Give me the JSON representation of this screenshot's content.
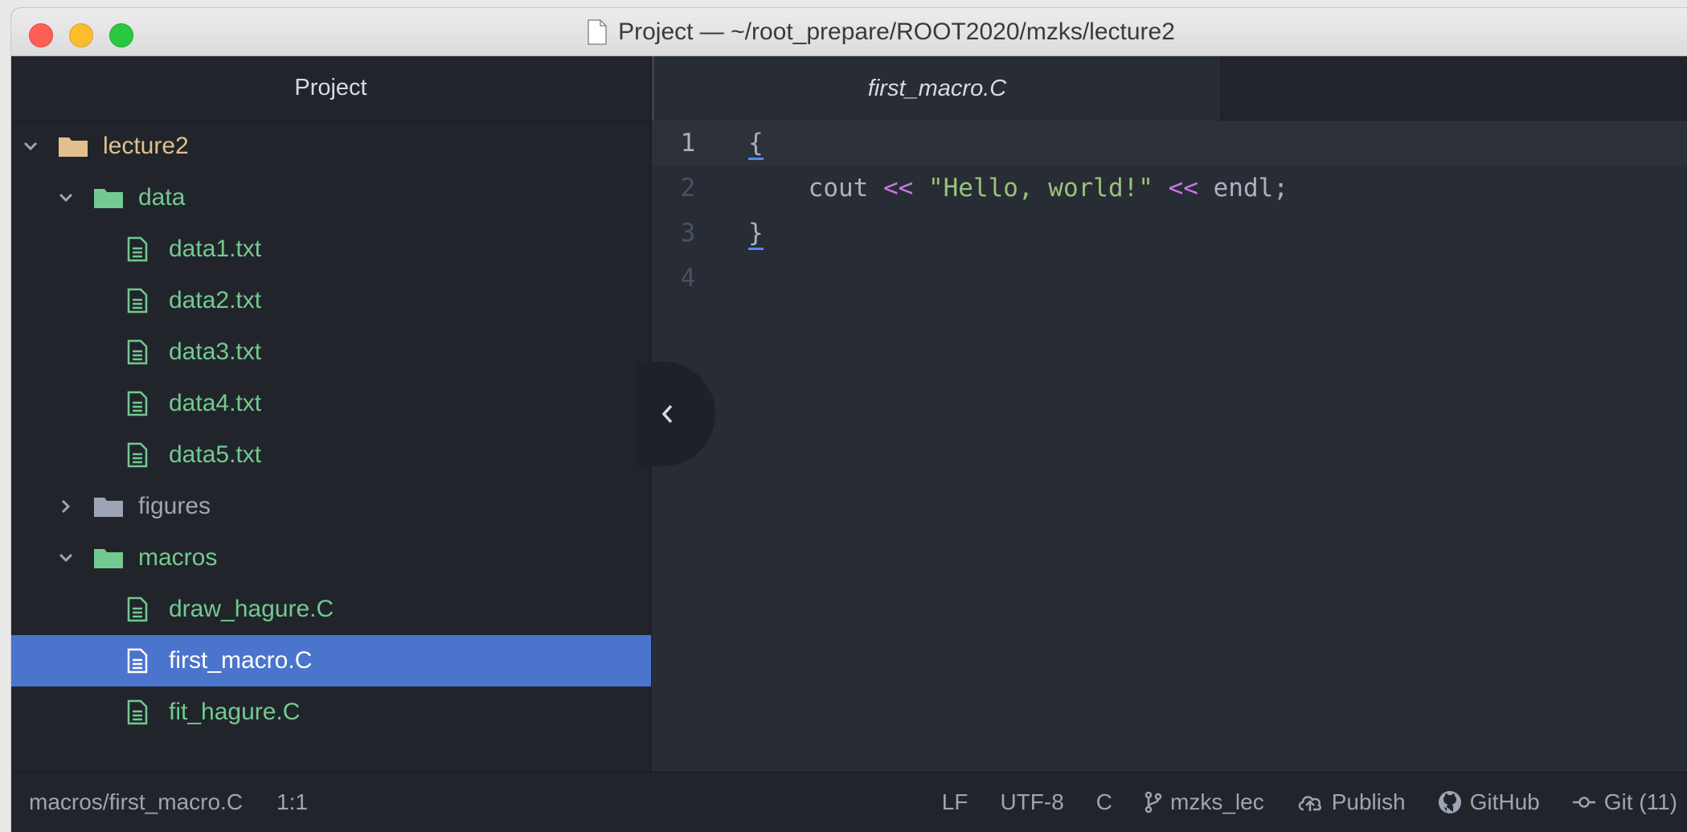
{
  "window": {
    "title": "Project — ~/root_prepare/ROOT2020/mzks/lecture2"
  },
  "sidebar": {
    "header": "Project",
    "tree": [
      {
        "label": "lecture2",
        "kind": "folder",
        "depth": 0,
        "expanded": true,
        "color": "tan"
      },
      {
        "label": "data",
        "kind": "folder",
        "depth": 1,
        "expanded": true,
        "color": "green"
      },
      {
        "label": "data1.txt",
        "kind": "file",
        "depth": 2,
        "color": "green"
      },
      {
        "label": "data2.txt",
        "kind": "file",
        "depth": 2,
        "color": "green"
      },
      {
        "label": "data3.txt",
        "kind": "file",
        "depth": 2,
        "color": "green"
      },
      {
        "label": "data4.txt",
        "kind": "file",
        "depth": 2,
        "color": "green"
      },
      {
        "label": "data5.txt",
        "kind": "file",
        "depth": 2,
        "color": "green"
      },
      {
        "label": "figures",
        "kind": "folder",
        "depth": 1,
        "expanded": false,
        "color": "grey"
      },
      {
        "label": "macros",
        "kind": "folder",
        "depth": 1,
        "expanded": true,
        "color": "green"
      },
      {
        "label": "draw_hagure.C",
        "kind": "file",
        "depth": 2,
        "color": "green"
      },
      {
        "label": "first_macro.C",
        "kind": "file",
        "depth": 2,
        "color": "white",
        "selected": true
      },
      {
        "label": "fit_hagure.C",
        "kind": "file",
        "depth": 2,
        "color": "green"
      }
    ]
  },
  "editor": {
    "tab_label": "first_macro.C",
    "line_numbers": [
      "1",
      "2",
      "3",
      "4"
    ],
    "lines": {
      "l1": "{",
      "l2_indent": "    cout ",
      "l2_op1": "<<",
      "l2_sp1": " ",
      "l2_str": "\"Hello, world!\"",
      "l2_sp2": " ",
      "l2_op2": "<<",
      "l2_tail": " endl;",
      "l3": "}",
      "l4": ""
    }
  },
  "statusbar": {
    "file_path": "macros/first_macro.C",
    "cursor": "1:1",
    "line_ending": "LF",
    "encoding": "UTF-8",
    "grammar": "C",
    "branch": "mzks_lec",
    "publish": "Publish",
    "github": "GitHub",
    "git": "Git (11)"
  },
  "colors": {
    "background": "#21252b",
    "editor_bg": "#282c34",
    "selection": "#4b74cc",
    "tree_green": "#73c990",
    "tree_tan": "#e2c08d"
  }
}
